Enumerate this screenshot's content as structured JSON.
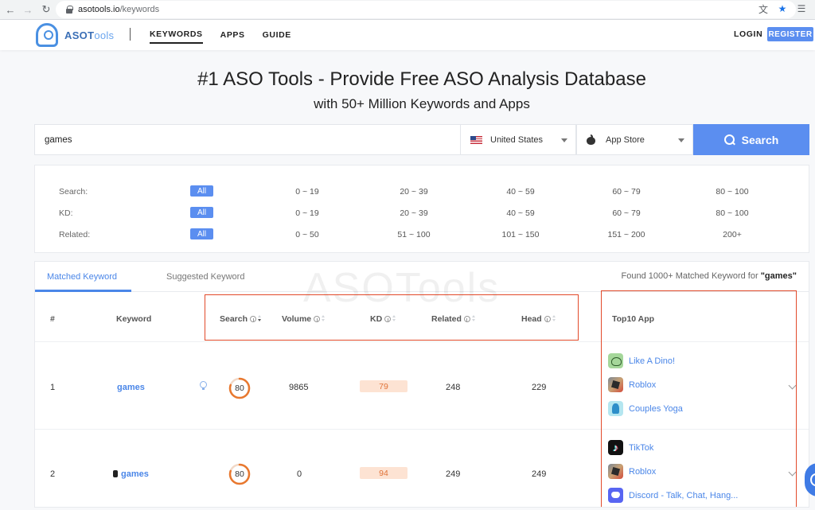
{
  "browser": {
    "url_host": "asotools.io",
    "url_path": "/keywords"
  },
  "header": {
    "logo_main": "ASOT",
    "logo_lite": "ools",
    "nav": [
      {
        "label": "KEYWORDS",
        "active": true
      },
      {
        "label": "APPS",
        "active": false
      },
      {
        "label": "GUIDE",
        "active": false
      }
    ],
    "login": "LOGIN",
    "register": "REGISTER"
  },
  "hero": {
    "title": "#1 ASO Tools - Provide Free ASO Analysis Database",
    "subtitle": "with 50+ Million Keywords and Apps"
  },
  "search": {
    "query": "games",
    "country": "United States",
    "store": "App Store",
    "button": "Search"
  },
  "filters": {
    "all_label": "All",
    "rows": [
      {
        "label": "Search:",
        "options": [
          "0 ~ 19",
          "20 ~ 39",
          "40 ~ 59",
          "60 ~ 79",
          "80 ~ 100"
        ]
      },
      {
        "label": "KD:",
        "options": [
          "0 ~ 19",
          "20 ~ 39",
          "40 ~ 59",
          "60 ~ 79",
          "80 ~ 100"
        ]
      },
      {
        "label": "Related:",
        "options": [
          "0 ~ 50",
          "51 ~ 100",
          "101 ~ 150",
          "151 ~ 200",
          "200+"
        ]
      }
    ]
  },
  "results": {
    "tabs": [
      "Matched Keyword",
      "Suggested Keyword"
    ],
    "found_prefix": "Found  1000+  Matched Keyword for ",
    "found_term": "\"games\"",
    "watermark": "ASOTools",
    "columns": {
      "num": "#",
      "keyword": "Keyword",
      "search": "Search",
      "volume": "Volume",
      "kd": "KD",
      "related": "Related",
      "head": "Head",
      "top10": "Top10 App"
    },
    "rows": [
      {
        "num": "1",
        "keyword": "games",
        "search": "80",
        "search_level": 0.8,
        "volume": "9865",
        "kd": "79",
        "related": "248",
        "head": "229",
        "apps": [
          "Like A Dino!",
          "Roblox",
          "Couples Yoga"
        ]
      },
      {
        "num": "2",
        "keyword": "games",
        "search": "80",
        "search_level": 0.8,
        "volume": "0",
        "kd": "94",
        "related": "249",
        "head": "249",
        "apps": [
          "TikTok",
          "Roblox",
          "Discord - Talk, Chat, Hang..."
        ]
      }
    ]
  },
  "colors": {
    "accent": "#5b8ef0",
    "link": "#4a86e8",
    "gauge": "#e8782f",
    "kd_bg": "#fde3d3",
    "highlight": "#e24a2a"
  },
  "icons": [
    "back-arrow-icon",
    "forward-arrow-icon",
    "reload-icon",
    "lock-icon",
    "translate-icon",
    "bookmark-star-icon",
    "reading-list-icon",
    "search-icon",
    "info-icon",
    "sort-icon",
    "lightbulb-icon",
    "chevron-down-icon",
    "chat-icon"
  ]
}
